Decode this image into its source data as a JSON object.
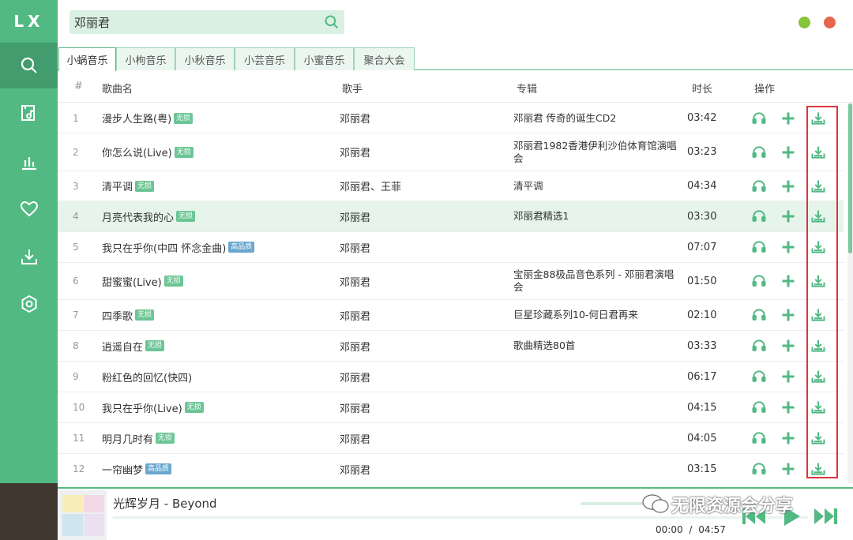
{
  "app": {
    "logo": "LX"
  },
  "search": {
    "value": "邓丽君"
  },
  "tabs": [
    "小蜗音乐",
    "小枸音乐",
    "小秋音乐",
    "小芸音乐",
    "小蜜音乐",
    "聚合大会"
  ],
  "table": {
    "headers": {
      "num": "#",
      "name": "歌曲名",
      "singer": "歌手",
      "album": "专辑",
      "duration": "时长",
      "ops": "操作"
    },
    "rows": [
      {
        "num": "1",
        "name": "漫步人生路(粤)",
        "badge": "无损",
        "singer": "邓丽君",
        "album": "邓丽君 传奇的诞生CD2",
        "duration": "03:42"
      },
      {
        "num": "2",
        "name": "你怎么说(Live)",
        "badge": "无损",
        "singer": "邓丽君",
        "album": "邓丽君1982香港伊利沙伯体育馆演唱会",
        "duration": "03:23"
      },
      {
        "num": "3",
        "name": "清平调",
        "badge": "无损",
        "singer": "邓丽君、王菲",
        "album": "清平调",
        "duration": "04:34"
      },
      {
        "num": "4",
        "name": "月亮代表我的心",
        "badge": "无损",
        "singer": "邓丽君",
        "album": "邓丽君精选1",
        "duration": "03:30"
      },
      {
        "num": "5",
        "name": "我只在乎你(中四 怀念金曲)",
        "badge": "高品质",
        "singer": "邓丽君",
        "album": "",
        "duration": "07:07"
      },
      {
        "num": "6",
        "name": "甜蜜蜜(Live)",
        "badge": "无损",
        "singer": "邓丽君",
        "album": "宝丽金88极品音色系列 - 邓丽君演唱会",
        "duration": "01:50"
      },
      {
        "num": "7",
        "name": "四季歌",
        "badge": "无损",
        "singer": "邓丽君",
        "album": "巨星珍藏系列10-何日君再来",
        "duration": "02:10"
      },
      {
        "num": "8",
        "name": "逍遥自在",
        "badge": "无损",
        "singer": "邓丽君",
        "album": "歌曲精选80首",
        "duration": "03:33"
      },
      {
        "num": "9",
        "name": "粉红色的回忆(快四)",
        "badge": "",
        "singer": "邓丽君",
        "album": "",
        "duration": "06:17"
      },
      {
        "num": "10",
        "name": "我只在乎你(Live)",
        "badge": "无损",
        "singer": "邓丽君",
        "album": "",
        "duration": "04:15"
      },
      {
        "num": "11",
        "name": "明月几时有",
        "badge": "无损",
        "singer": "邓丽君",
        "album": "",
        "duration": "04:05"
      },
      {
        "num": "12",
        "name": "一帘幽梦",
        "badge": "高品质",
        "singer": "邓丽君",
        "album": "",
        "duration": "03:15"
      }
    ]
  },
  "player": {
    "title": "光辉岁月 - Beyond",
    "current_time": "00:00",
    "total_time": "04:57",
    "time_separator": "/"
  },
  "watermark": "无限资源会分享",
  "colors": {
    "accent": "#52b983",
    "accent_dark": "#429c6d",
    "badge_lossless": "#6cc595",
    "badge_hq": "#6aa7cf",
    "highlight_box": "#d9363e"
  }
}
